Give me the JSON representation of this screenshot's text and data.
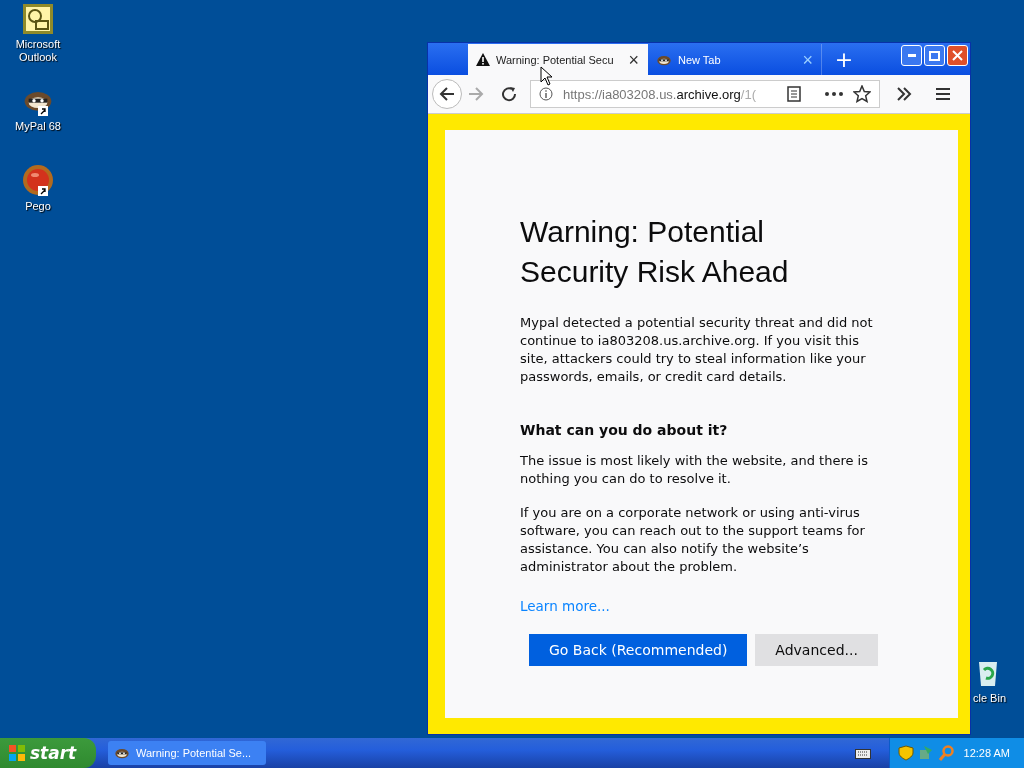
{
  "desktop_icons": [
    {
      "kind": "outlook",
      "label": "Microsoft Outlook",
      "shortcut": false
    },
    {
      "kind": "mypal",
      "label": "MyPal 68",
      "shortcut": true
    },
    {
      "kind": "pego",
      "label": "Pego",
      "shortcut": true
    }
  ],
  "recycle_bin": {
    "label": "cle Bin"
  },
  "browser": {
    "tabs": [
      {
        "title": "Warning: Potential Secu",
        "kind": "warning",
        "selected": true,
        "close": "×"
      },
      {
        "title": "New Tab",
        "kind": "mypal",
        "selected": false,
        "close": "×"
      }
    ],
    "new_tab": "+",
    "url": {
      "prefix": "https://ia803208.us.",
      "domain": "archive.org",
      "suffix": "/1("
    },
    "page": {
      "heading": "Warning: Potential Security Risk Ahead",
      "intro": "Mypal detected a potential security threat and did not continue to ia803208.us.archive.org. If you visit this site, attackers could try to steal information like your passwords, emails, or credit card details.",
      "subheading": "What can you do about it?",
      "paragraphs": [
        "The issue is most likely with the website, and there is nothing you can do to resolve it.",
        "If you are on a corporate network or using anti-virus software, you can reach out to the support teams for assistance. You can also notify the website’s administrator about the problem."
      ],
      "link": "Learn more...",
      "buttons": [
        {
          "label": "Go Back (Recommended)",
          "kind": "primary"
        },
        {
          "label": "Advanced...",
          "kind": "secondary"
        }
      ]
    }
  },
  "taskbar": {
    "start": "start",
    "tasks": [
      {
        "label": "Warning: Potential Se...",
        "selected": false
      }
    ],
    "clock": "12:28 AM"
  }
}
